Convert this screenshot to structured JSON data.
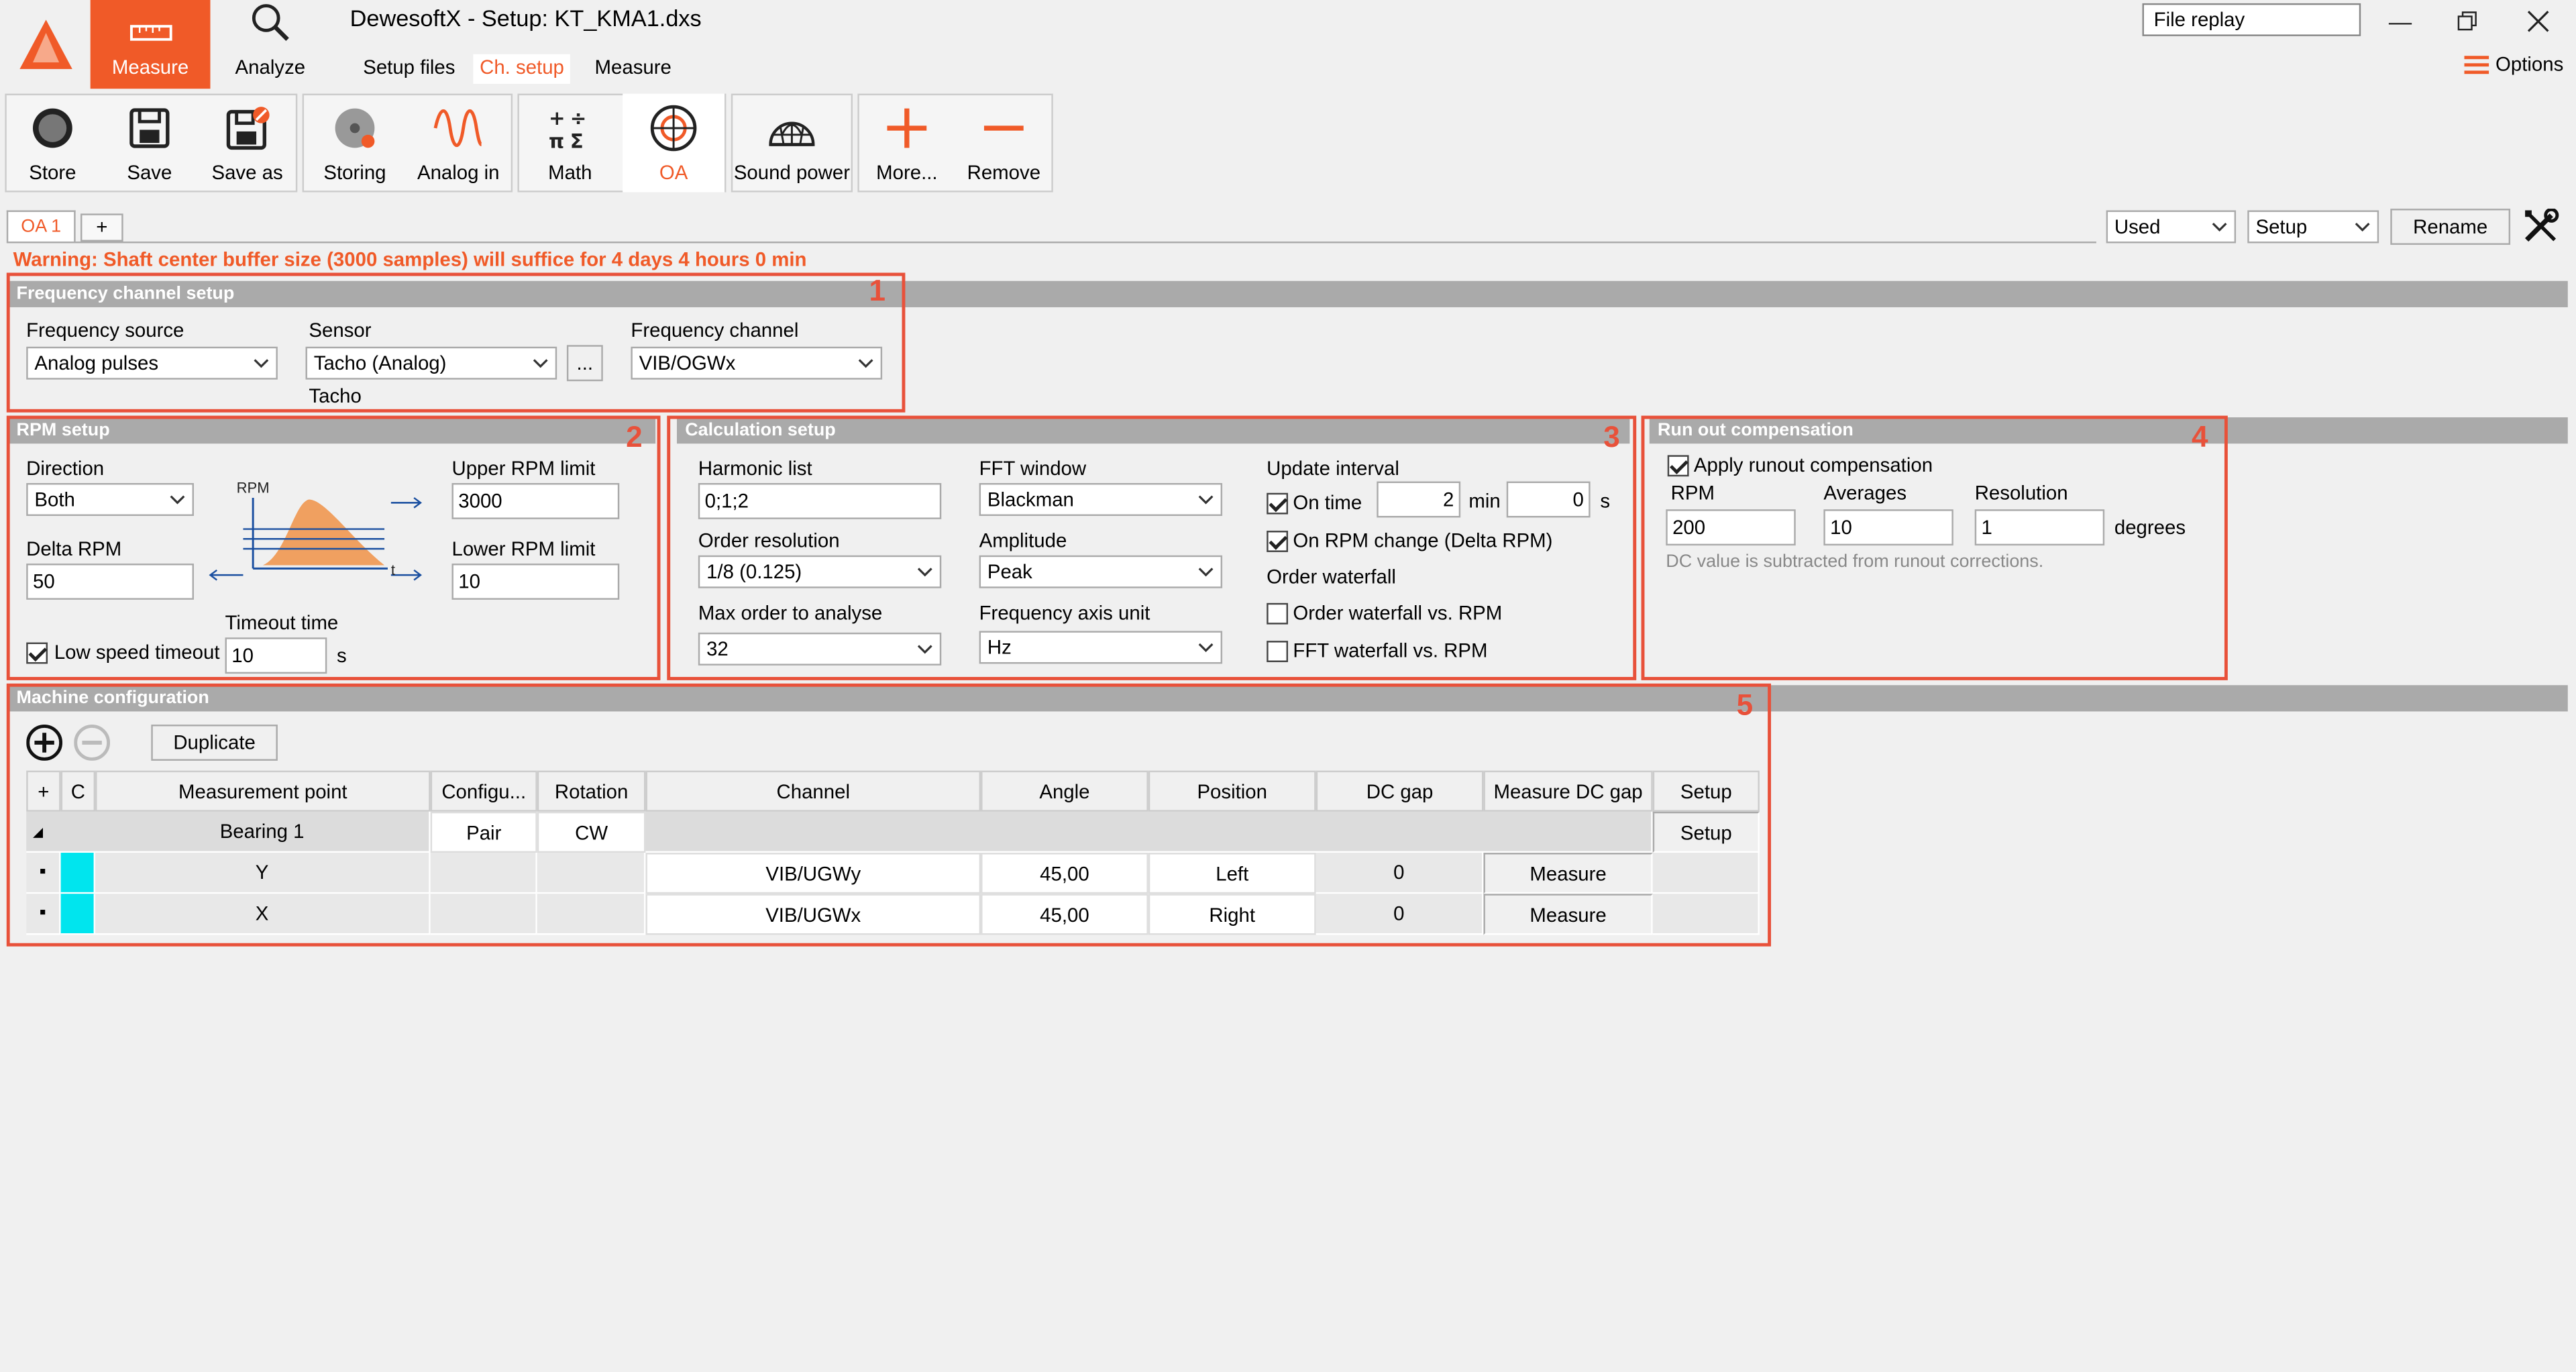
{
  "titlebar": {
    "window_title": "DewesoftX - Setup: KT_KMA1.dxs",
    "nav_measure": "Measure",
    "nav_analyze": "Analyze",
    "sub_setup_files": "Setup files",
    "sub_ch_setup": "Ch. setup",
    "sub_measure": "Measure",
    "file_replay": "File replay",
    "options": "Options",
    "accent": "#f05a28"
  },
  "toolbar": {
    "store": "Store",
    "save": "Save",
    "save_as": "Save as",
    "storing": "Storing",
    "analog_in": "Analog in",
    "math": "Math",
    "oa": "OA",
    "sound_power": "Sound power",
    "more": "More...",
    "remove": "Remove"
  },
  "tabs": {
    "oa1": "OA 1",
    "plus": "+",
    "used": "Used",
    "setup": "Setup",
    "rename": "Rename"
  },
  "warning": "Warning: Shaft center buffer size (3000 samples) will suffice for 4 days 4 hours 0 min",
  "freq": {
    "header": "Frequency channel setup",
    "num": "1",
    "source_label": "Frequency source",
    "source_value": "Analog pulses",
    "sensor_label": "Sensor",
    "sensor_value": "Tacho (Analog)",
    "sensor_sub": "Tacho",
    "more_btn": "...",
    "channel_label": "Frequency channel",
    "channel_value": "VIB/OGWx"
  },
  "rpm": {
    "header": "RPM setup",
    "num": "2",
    "direction_label": "Direction",
    "direction_value": "Both",
    "delta_label": "Delta RPM",
    "delta_value": "50",
    "upper_label": "Upper RPM limit",
    "upper_value": "3000",
    "lower_label": "Lower RPM limit",
    "lower_value": "10",
    "low_speed_label": "Low speed timeout",
    "timeout_label": "Timeout time",
    "timeout_value": "10",
    "timeout_unit": "s",
    "graph_rpm": "RPM",
    "graph_t": "t"
  },
  "calc": {
    "header": "Calculation setup",
    "num": "3",
    "harmonic_label": "Harmonic list",
    "harmonic_value": "0;1;2",
    "order_res_label": "Order resolution",
    "order_res_value": "1/8 (0.125)",
    "max_order_label": "Max order to analyse",
    "max_order_value": "32",
    "fft_label": "FFT window",
    "fft_value": "Blackman",
    "amp_label": "Amplitude",
    "amp_value": "Peak",
    "axis_label": "Frequency axis unit",
    "axis_value": "Hz",
    "update_label": "Update interval",
    "on_time": "On time",
    "min_value": "2",
    "min_unit": "min",
    "s_value": "0",
    "s_unit": "s",
    "on_rpm": "On RPM change (Delta RPM)",
    "order_waterfall": "Order waterfall",
    "order_wf_rpm": "Order waterfall vs. RPM",
    "fft_wf_rpm": "FFT waterfall vs. RPM"
  },
  "runout": {
    "header": "Run out compensation",
    "num": "4",
    "apply": "Apply runout compensation",
    "rpm_label": "RPM",
    "rpm_value": "200",
    "avg_label": "Averages",
    "avg_value": "10",
    "res_label": "Resolution",
    "res_value": "1",
    "res_unit": "degrees",
    "note": "DC value is subtracted from runout corrections."
  },
  "machine": {
    "header": "Machine configuration",
    "num": "5",
    "duplicate": "Duplicate",
    "columns": [
      "+",
      "C",
      "Measurement point",
      "Configu...",
      "Rotation",
      "Channel",
      "Angle",
      "Position",
      "DC gap",
      "Measure DC gap",
      "Setup"
    ],
    "group": {
      "name": "Bearing 1",
      "config": "Pair",
      "rotation": "CW",
      "setup": "Setup"
    },
    "rows": [
      {
        "point": "Y",
        "channel": "VIB/UGWy",
        "angle": "45,00",
        "position": "Left",
        "dcgap": "0",
        "measure": "Measure"
      },
      {
        "point": "X",
        "channel": "VIB/UGWx",
        "angle": "45,00",
        "position": "Right",
        "dcgap": "0",
        "measure": "Measure"
      }
    ],
    "row_color": "#00e5ee"
  }
}
